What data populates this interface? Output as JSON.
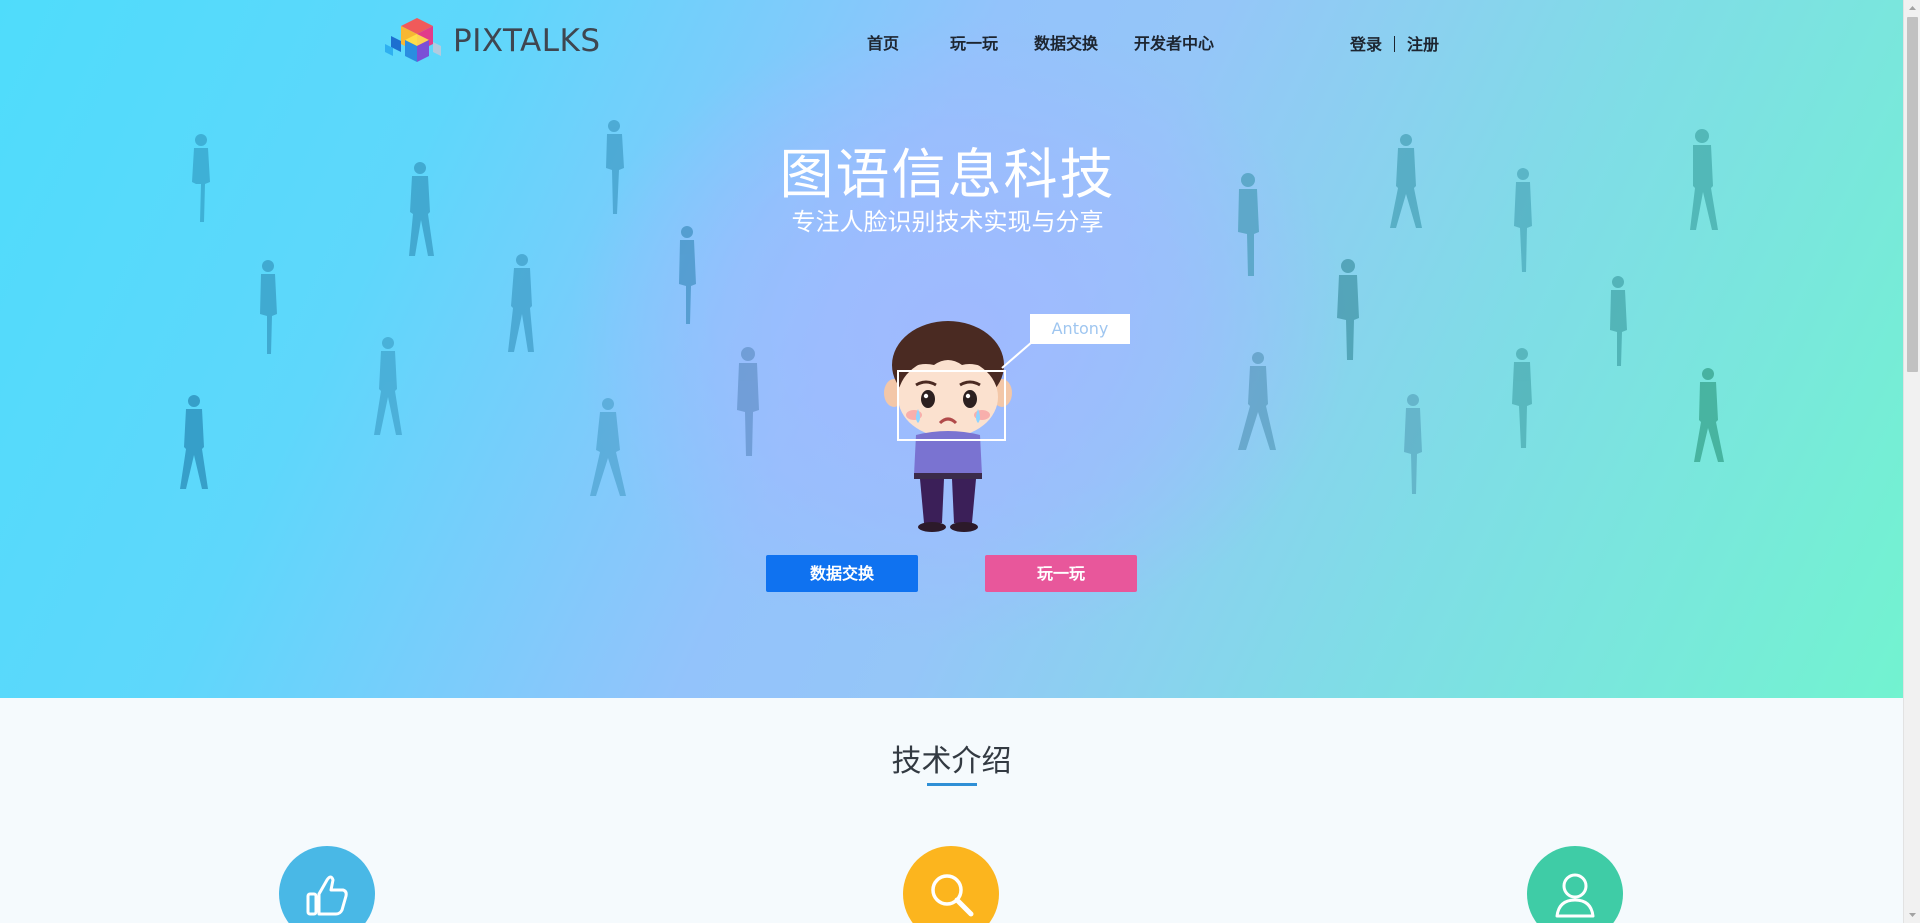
{
  "brand": {
    "name": "PIXTALKS",
    "logo_icon": "cube-logo-icon"
  },
  "nav": {
    "items": [
      {
        "label": "首页"
      },
      {
        "label": "玩一玩"
      },
      {
        "label": "数据交换"
      },
      {
        "label": "开发者中心"
      }
    ],
    "login": "登录",
    "register": "注册"
  },
  "hero": {
    "title": "图语信息科技",
    "subtitle": "专注人脸识别技术实现与分享",
    "name_tag": "Antony",
    "buttons": {
      "exchange": "数据交换",
      "play": "玩一玩"
    }
  },
  "section": {
    "title": "技术介绍",
    "features": [
      {
        "icon": "thumbs-up-icon",
        "color": "#49b8e6"
      },
      {
        "icon": "search-icon",
        "color": "#fcb51e"
      },
      {
        "icon": "user-icon",
        "color": "#3fcca6"
      }
    ]
  },
  "colors": {
    "primary_button": "#0f72f0",
    "secondary_button": "#e8579b",
    "hero_gradient": [
      "#4fdcfb",
      "#95c6f8",
      "#72f3d0"
    ]
  }
}
